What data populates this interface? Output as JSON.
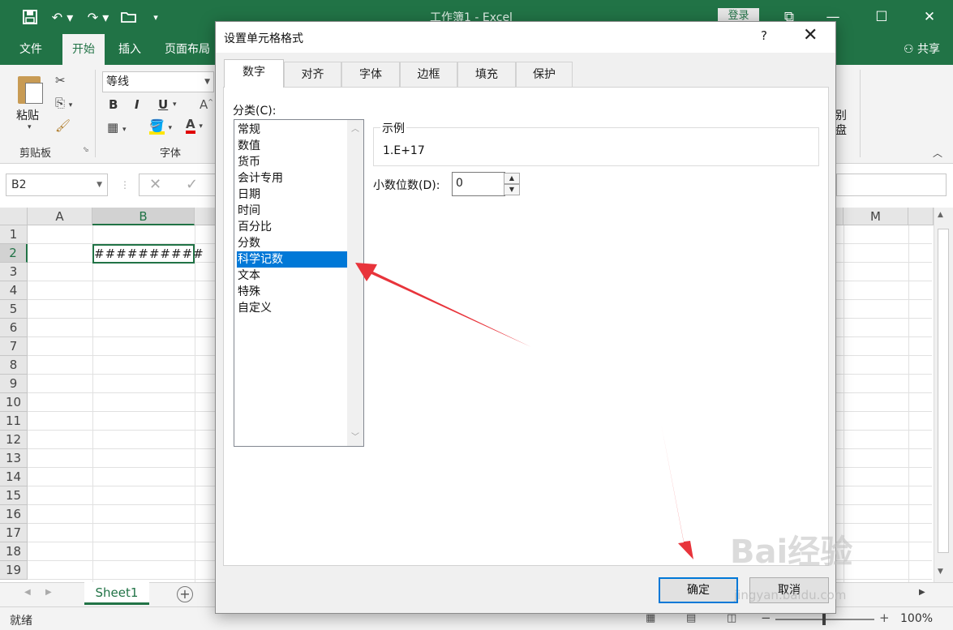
{
  "excel": {
    "title": "工作簿1 - Excel",
    "login": "登录",
    "share": "共享",
    "ribbon_tabs": [
      "文件",
      "开始",
      "插入",
      "页面布局"
    ],
    "ribbon": {
      "paste": "粘贴",
      "clipboard_group": "剪贴板",
      "font_name": "等线",
      "font_group": "字体",
      "bold": "B",
      "italic": "I",
      "underline": "U",
      "font_color_letter": "A",
      "right_cut_1": "别",
      "right_cut_2": "盘"
    },
    "name_box": "B2",
    "columns": [
      "A",
      "B",
      "M"
    ],
    "rows": [
      "1",
      "2",
      "3",
      "4",
      "5",
      "6",
      "7",
      "8",
      "9",
      "10",
      "11",
      "12",
      "13",
      "14",
      "15",
      "16",
      "17",
      "18",
      "19"
    ],
    "active_cell_value": "##########",
    "sheet_tab": "Sheet1",
    "status": "就绪",
    "zoom": "100%"
  },
  "dialog": {
    "title": "设置单元格格式",
    "help": "?",
    "tabs": [
      "数字",
      "对齐",
      "字体",
      "边框",
      "填充",
      "保护"
    ],
    "active_tab": "数字",
    "category_label": "分类(C):",
    "categories": [
      "常规",
      "数值",
      "货币",
      "会计专用",
      "日期",
      "时间",
      "百分比",
      "分数",
      "科学记数",
      "文本",
      "特殊",
      "自定义"
    ],
    "selected_category": "科学记数",
    "sample_label": "示例",
    "sample_value": "1.E+17",
    "decimal_label": "小数位数(D):",
    "decimal_value": "0",
    "ok_label": "确定",
    "cancel_label": "取消"
  },
  "annotation_colors": {
    "arrow": "#e8343b"
  },
  "watermark": {
    "logo": "Bai经验",
    "url": "jingyan.baidu.com"
  }
}
